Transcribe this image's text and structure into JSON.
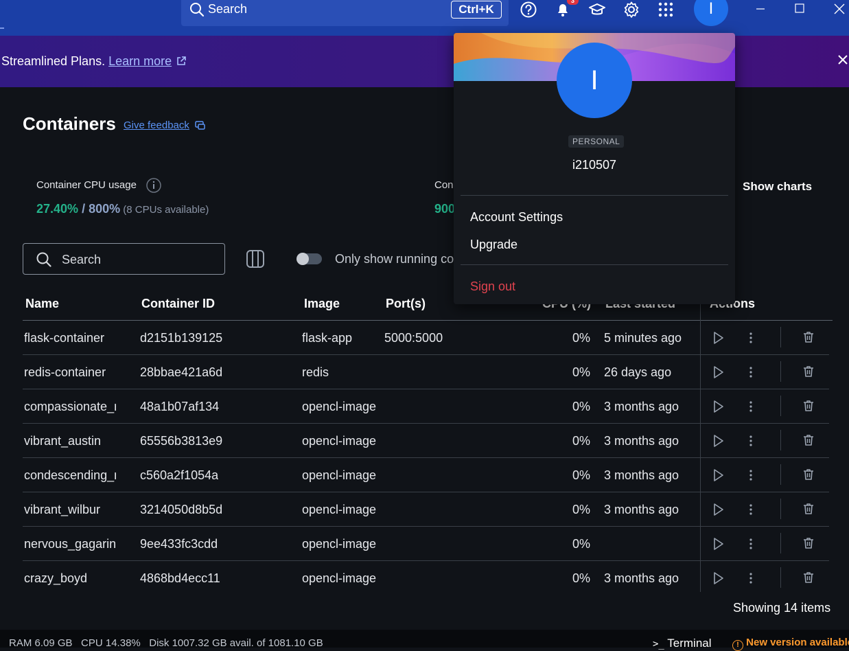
{
  "titlebar": {
    "search_label": "Search",
    "search_shortcut": "Ctrl+K",
    "notification_count": "3",
    "avatar_initial": "I"
  },
  "promo": {
    "text": "Streamlined Plans. ",
    "link": "Learn more"
  },
  "page": {
    "title": "Containers",
    "feedback_link": "Give feedback"
  },
  "stats": {
    "cpu_label": "Container CPU usage",
    "cpu_percent": "27.40%",
    "cpu_separator": " / ",
    "cpu_max": "800%",
    "cpu_note": " (8 CPUs available)",
    "memory_label_partial": "Con",
    "memory_value_partial": "900",
    "show_charts": "Show charts"
  },
  "filters": {
    "search_placeholder": "Search",
    "toggle_label": "Only show running co"
  },
  "table": {
    "headers": {
      "name": "Name",
      "id": "Container ID",
      "image": "Image",
      "ports": "Port(s)",
      "cpu": "CPU (%)",
      "last_started": "Last started",
      "actions": "Actions"
    },
    "rows": [
      {
        "name": "flask-container",
        "id": "d2151b139125",
        "image": "flask-app",
        "ports": "5000:5000",
        "cpu": "0%",
        "last": "5 minutes ago"
      },
      {
        "name": "redis-container",
        "id": "28bbae421a6d",
        "image": "redis",
        "ports": "",
        "cpu": "0%",
        "last": "26 days ago"
      },
      {
        "name": "compassionate_rhodes",
        "id": "48a1b07af134",
        "image": "opencl-image",
        "ports": "",
        "cpu": "0%",
        "last": "3 months ago"
      },
      {
        "name": "vibrant_austin",
        "id": "65556b3813e9",
        "image": "opencl-image",
        "ports": "",
        "cpu": "0%",
        "last": "3 months ago"
      },
      {
        "name": "condescending_northcutt",
        "id": "c560a2f1054a",
        "image": "opencl-image",
        "ports": "",
        "cpu": "0%",
        "last": "3 months ago"
      },
      {
        "name": "vibrant_wilbur",
        "id": "3214050d8b5d",
        "image": "opencl-image",
        "ports": "",
        "cpu": "0%",
        "last": "3 months ago"
      },
      {
        "name": "nervous_gagarin",
        "id": "9ee433fc3cdd",
        "image": "opencl-image",
        "ports": "",
        "cpu": "0%",
        "last": ""
      },
      {
        "name": "crazy_boyd",
        "id": "4868bd4ecc11",
        "image": "opencl-image",
        "ports": "",
        "cpu": "0%",
        "last": "3 months ago"
      }
    ],
    "footer": "Showing 14 items"
  },
  "statusbar": {
    "resources": "RAM 6.09 GB   CPU 14.38%   Disk 1007.32 GB avail. of 1081.10 GB",
    "terminal": "Terminal",
    "new_version": "New version available"
  },
  "account_menu": {
    "avatar_initial": "I",
    "plan_badge": "PERSONAL",
    "username": "i210507",
    "account_settings": "Account Settings",
    "upgrade": "Upgrade",
    "sign_out": "Sign out"
  },
  "colors": {
    "titlebar": "#1b3fa6",
    "accent_green": "#24b28a",
    "avatar_blue": "#1f6fea",
    "sign_out_red": "#e0434f",
    "new_version_orange": "#ff9a2e"
  }
}
